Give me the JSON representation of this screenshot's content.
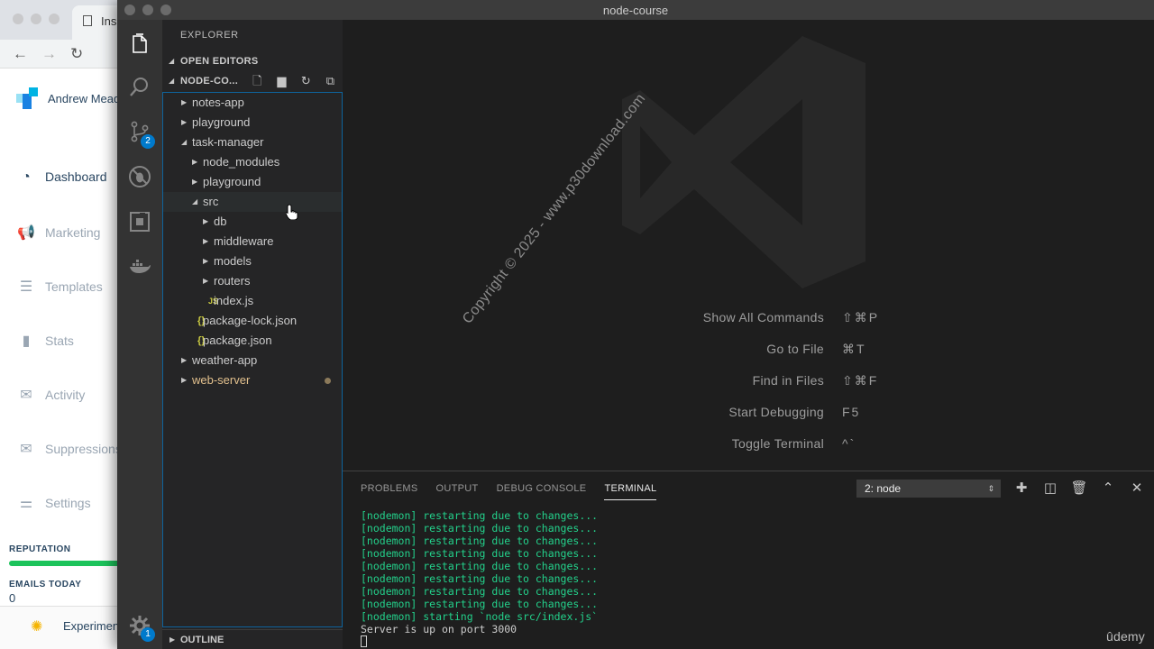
{
  "browser": {
    "tab_title": "Ins",
    "brand_name": "Andrew Mead",
    "menu": [
      {
        "label": "Dashboard",
        "icon": "gauge-icon"
      },
      {
        "label": "Marketing",
        "icon": "megaphone-icon"
      },
      {
        "label": "Templates",
        "icon": "templates-icon"
      },
      {
        "label": "Stats",
        "icon": "bar-chart-icon"
      },
      {
        "label": "Activity",
        "icon": "activity-icon"
      },
      {
        "label": "Suppressions",
        "icon": "suppression-icon"
      },
      {
        "label": "Settings",
        "icon": "sliders-icon"
      }
    ],
    "reputation_label": "REPUTATION",
    "emails_today_label": "EMAILS TODAY",
    "emails_today_value": "0",
    "experiments_label": "Experimen",
    "reputation_bar_color": "#1cc35b"
  },
  "vscode": {
    "window_title": "node-course",
    "activity": {
      "scm_badge": "2",
      "settings_badge": "1"
    },
    "sidebar": {
      "title": "EXPLORER",
      "open_editors": "OPEN EDITORS",
      "folder": "NODE-CO...",
      "outline": "OUTLINE"
    },
    "tree": [
      {
        "label": "notes-app",
        "depth": 0,
        "type": "folder",
        "expanded": false
      },
      {
        "label": "playground",
        "depth": 0,
        "type": "folder",
        "expanded": false
      },
      {
        "label": "task-manager",
        "depth": 0,
        "type": "folder",
        "expanded": true
      },
      {
        "label": "node_modules",
        "depth": 1,
        "type": "folder",
        "expanded": false
      },
      {
        "label": "playground",
        "depth": 1,
        "type": "folder",
        "expanded": false
      },
      {
        "label": "src",
        "depth": 1,
        "type": "folder",
        "expanded": true,
        "selected": true
      },
      {
        "label": "db",
        "depth": 2,
        "type": "folder",
        "expanded": false
      },
      {
        "label": "middleware",
        "depth": 2,
        "type": "folder",
        "expanded": false
      },
      {
        "label": "models",
        "depth": 2,
        "type": "folder",
        "expanded": false
      },
      {
        "label": "routers",
        "depth": 2,
        "type": "folder",
        "expanded": false
      },
      {
        "label": "index.js",
        "depth": 2,
        "type": "js",
        "icon_text": "JS"
      },
      {
        "label": "package-lock.json",
        "depth": 1,
        "type": "json",
        "icon_text": "{}"
      },
      {
        "label": "package.json",
        "depth": 1,
        "type": "json",
        "icon_text": "{}"
      },
      {
        "label": "weather-app",
        "depth": 0,
        "type": "folder",
        "expanded": false
      },
      {
        "label": "web-server",
        "depth": 0,
        "type": "folder",
        "expanded": false,
        "modified": true
      }
    ],
    "editor": {
      "watermark": "Copyright © 2025 - www.p30download.com",
      "commands": [
        {
          "label": "Show All Commands",
          "key": "⇧⌘P"
        },
        {
          "label": "Go to File",
          "key": "⌘T"
        },
        {
          "label": "Find in Files",
          "key": "⇧⌘F"
        },
        {
          "label": "Start Debugging",
          "key": "F5"
        },
        {
          "label": "Toggle Terminal",
          "key": "^`"
        }
      ]
    },
    "panel": {
      "tabs": [
        {
          "label": "PROBLEMS",
          "active": false
        },
        {
          "label": "OUTPUT",
          "active": false
        },
        {
          "label": "DEBUG CONSOLE",
          "active": false
        },
        {
          "label": "TERMINAL",
          "active": true
        }
      ],
      "terminal_select": "2: node",
      "terminal_lines": [
        {
          "text": "[nodemon] restarting due to changes...",
          "color": "green"
        },
        {
          "text": "[nodemon] restarting due to changes...",
          "color": "green"
        },
        {
          "text": "[nodemon] restarting due to changes...",
          "color": "green"
        },
        {
          "text": "[nodemon] restarting due to changes...",
          "color": "green"
        },
        {
          "text": "[nodemon] restarting due to changes...",
          "color": "green"
        },
        {
          "text": "[nodemon] restarting due to changes...",
          "color": "green"
        },
        {
          "text": "[nodemon] restarting due to changes...",
          "color": "green"
        },
        {
          "text": "[nodemon] restarting due to changes...",
          "color": "green"
        },
        {
          "text": "[nodemon] starting `node src/index.js`",
          "color": "green"
        },
        {
          "text": "Server is up on port 3000",
          "color": "default"
        }
      ]
    },
    "udemy": "ûdemy"
  }
}
